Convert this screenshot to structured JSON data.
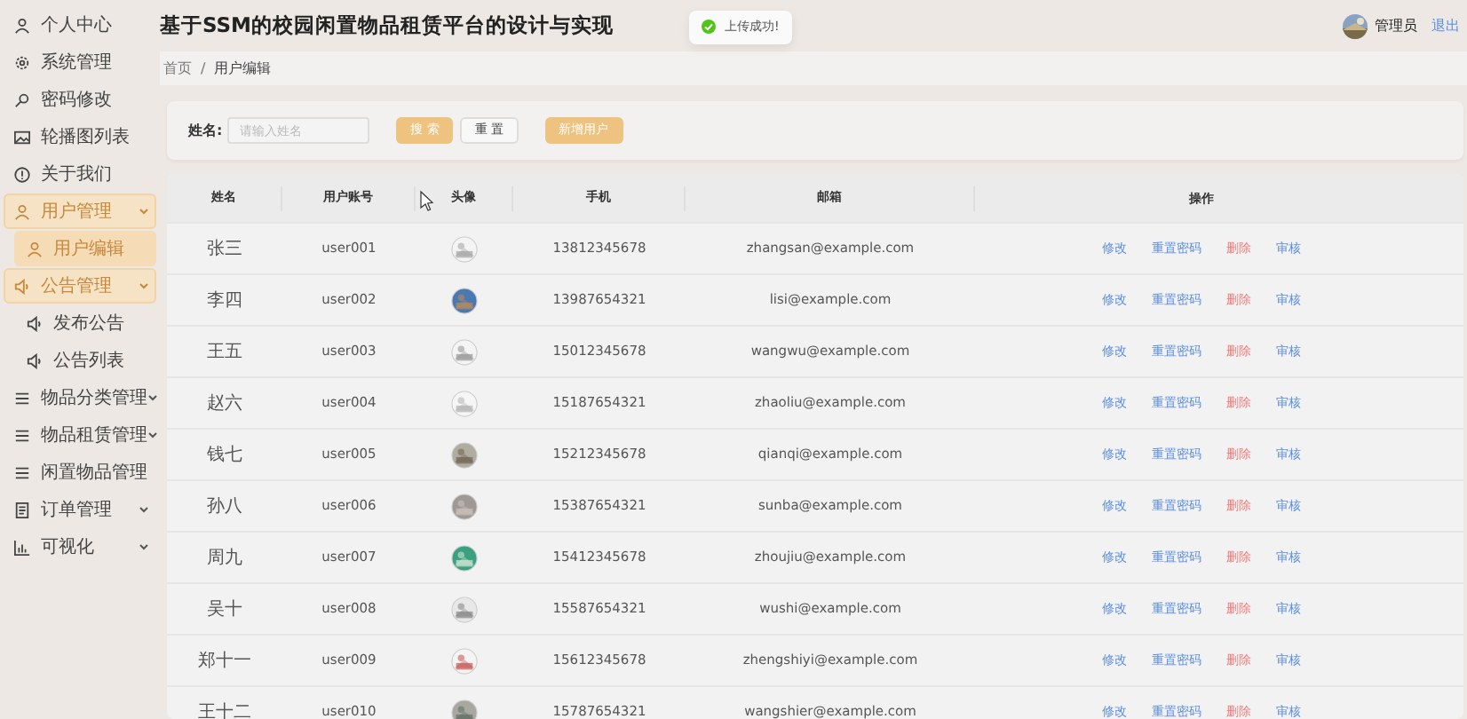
{
  "sidebar": {
    "items": [
      {
        "label": "个人中心",
        "selected": false,
        "expanded": false,
        "has_children": false
      },
      {
        "label": "系统管理",
        "selected": false,
        "expanded": false,
        "has_children": false
      },
      {
        "label": "密码修改",
        "selected": false,
        "expanded": false,
        "has_children": false
      },
      {
        "label": "轮播图列表",
        "selected": false,
        "expanded": false,
        "has_children": false
      },
      {
        "label": "关于我们",
        "selected": false,
        "expanded": false,
        "has_children": false
      },
      {
        "label": "用户管理",
        "selected": false,
        "expanded": true,
        "has_children": true,
        "children": [
          {
            "label": "用户编辑",
            "selected": true
          }
        ]
      },
      {
        "label": "公告管理",
        "selected": false,
        "expanded": true,
        "has_children": true,
        "children": [
          {
            "label": "发布公告",
            "selected": false
          },
          {
            "label": "公告列表",
            "selected": false
          }
        ]
      },
      {
        "label": "物品分类管理",
        "selected": false,
        "expanded": false,
        "has_children": true
      },
      {
        "label": "物品租赁管理",
        "selected": false,
        "expanded": false,
        "has_children": true
      },
      {
        "label": "闲置物品管理",
        "selected": false,
        "expanded": false,
        "has_children": false
      },
      {
        "label": "订单管理",
        "selected": false,
        "expanded": false,
        "has_children": true
      },
      {
        "label": "可视化",
        "selected": false,
        "expanded": false,
        "has_children": true
      }
    ]
  },
  "header": {
    "title": "基于SSM的校园闲置物品租赁平台的设计与实现",
    "user": "管理员",
    "logout": "退出"
  },
  "toast": {
    "message": "上传成功!"
  },
  "breadcrumb": {
    "items": [
      "首页",
      "用户编辑"
    ],
    "separator": "/"
  },
  "search": {
    "label": "姓名:",
    "placeholder": "请输入姓名",
    "search_button": "搜 索",
    "reset_button": "重 置",
    "add_button": "新增用户"
  },
  "table": {
    "columns": [
      "姓名",
      "用户账号",
      "头像",
      "手机",
      "邮箱",
      "操作"
    ],
    "rows": [
      {
        "name": "张三",
        "account": "user001",
        "phone": "13812345678",
        "email": "zhangsan@example.com",
        "actions": [
          {
            "label": "修改",
            "kind": "link"
          },
          {
            "label": "重置密码",
            "kind": "link"
          },
          {
            "label": "删除",
            "kind": "danger"
          },
          {
            "label": "审核",
            "kind": "link"
          }
        ]
      },
      {
        "name": "李四",
        "account": "user002",
        "phone": "13987654321",
        "email": "lisi@example.com",
        "actions": [
          {
            "label": "修改",
            "kind": "link"
          },
          {
            "label": "重置密码",
            "kind": "link"
          },
          {
            "label": "删除",
            "kind": "danger"
          },
          {
            "label": "审核",
            "kind": "link"
          }
        ]
      },
      {
        "name": "王五",
        "account": "user003",
        "phone": "15012345678",
        "email": "wangwu@example.com",
        "actions": [
          {
            "label": "修改",
            "kind": "link"
          },
          {
            "label": "重置密码",
            "kind": "link"
          },
          {
            "label": "删除",
            "kind": "danger"
          },
          {
            "label": "审核",
            "kind": "link"
          }
        ]
      },
      {
        "name": "赵六",
        "account": "user004",
        "phone": "15187654321",
        "email": "zhaoliu@example.com",
        "actions": [
          {
            "label": "修改",
            "kind": "link"
          },
          {
            "label": "重置密码",
            "kind": "link"
          },
          {
            "label": "删除",
            "kind": "danger"
          },
          {
            "label": "审核",
            "kind": "link"
          }
        ]
      },
      {
        "name": "钱七",
        "account": "user005",
        "phone": "15212345678",
        "email": "qianqi@example.com",
        "actions": [
          {
            "label": "修改",
            "kind": "link"
          },
          {
            "label": "重置密码",
            "kind": "link"
          },
          {
            "label": "删除",
            "kind": "danger"
          },
          {
            "label": "审核",
            "kind": "link"
          }
        ]
      },
      {
        "name": "孙八",
        "account": "user006",
        "phone": "15387654321",
        "email": "sunba@example.com",
        "actions": [
          {
            "label": "修改",
            "kind": "link"
          },
          {
            "label": "重置密码",
            "kind": "link"
          },
          {
            "label": "删除",
            "kind": "danger"
          },
          {
            "label": "审核",
            "kind": "link"
          }
        ]
      },
      {
        "name": "周九",
        "account": "user007",
        "phone": "15412345678",
        "email": "zhoujiu@example.com",
        "actions": [
          {
            "label": "修改",
            "kind": "link"
          },
          {
            "label": "重置密码",
            "kind": "link"
          },
          {
            "label": "删除",
            "kind": "danger"
          },
          {
            "label": "审核",
            "kind": "link"
          }
        ]
      },
      {
        "name": "吴十",
        "account": "user008",
        "phone": "15587654321",
        "email": "wushi@example.com",
        "actions": [
          {
            "label": "修改",
            "kind": "link"
          },
          {
            "label": "重置密码",
            "kind": "link"
          },
          {
            "label": "删除",
            "kind": "danger"
          },
          {
            "label": "审核",
            "kind": "link"
          }
        ]
      },
      {
        "name": "郑十一",
        "account": "user009",
        "phone": "15612345678",
        "email": "zhengshiyi@example.com",
        "actions": [
          {
            "label": "修改",
            "kind": "link"
          },
          {
            "label": "重置密码",
            "kind": "link"
          },
          {
            "label": "删除",
            "kind": "danger"
          },
          {
            "label": "审核",
            "kind": "link"
          }
        ]
      },
      {
        "name": "王十二",
        "account": "user010",
        "phone": "15787654321",
        "email": "wangshier@example.com",
        "actions": [
          {
            "label": "修改",
            "kind": "link"
          },
          {
            "label": "重置密码",
            "kind": "link"
          },
          {
            "label": "删除",
            "kind": "danger"
          },
          {
            "label": "审核",
            "kind": "link"
          }
        ]
      }
    ]
  }
}
